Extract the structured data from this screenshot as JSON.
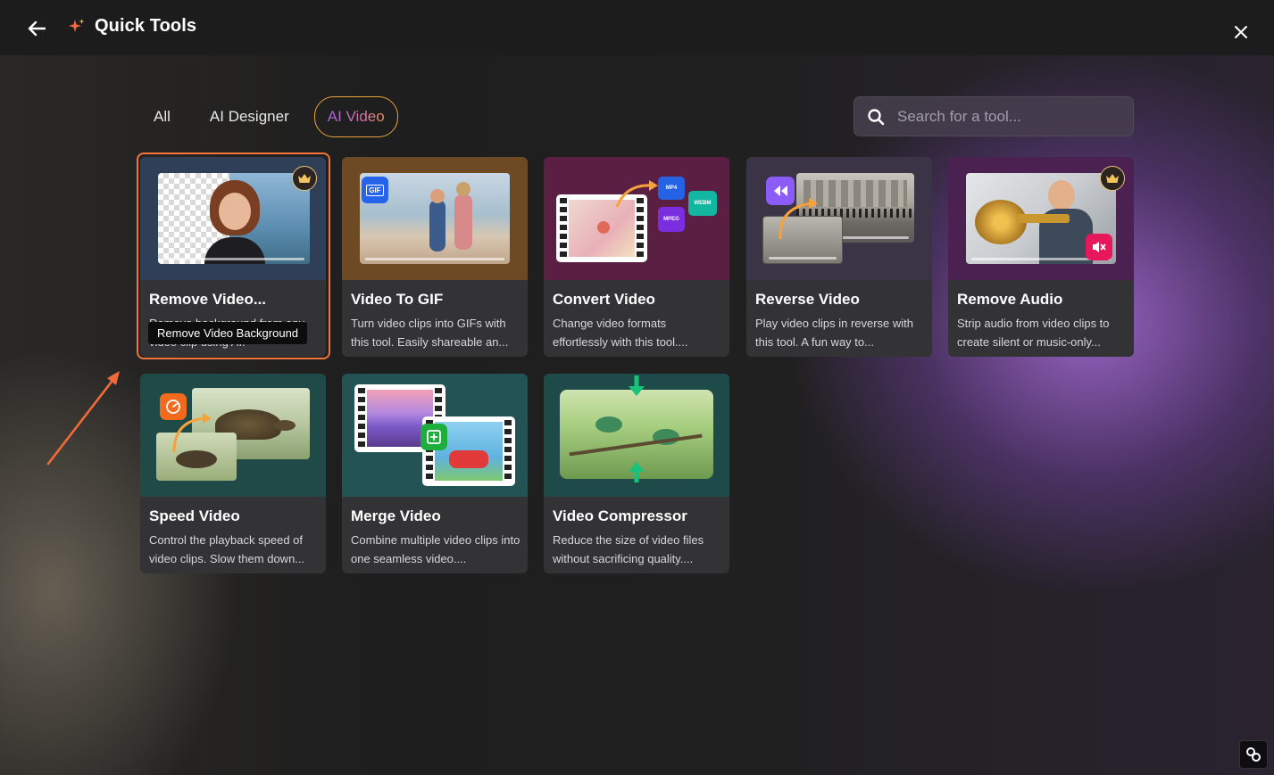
{
  "header": {
    "title": "Quick Tools"
  },
  "tabs": [
    {
      "label": "All"
    },
    {
      "label": "AI Designer"
    },
    {
      "label": "AI Video"
    }
  ],
  "search": {
    "placeholder": "Search for a tool..."
  },
  "cards": [
    {
      "title": "Remove Video...",
      "desc": "Remove background from any video clip using AI.",
      "premium": true,
      "thumb_bg": "#2e3f57"
    },
    {
      "title": "Video To GIF",
      "desc": "Turn video clips into GIFs with this tool. Easily shareable an...",
      "premium": false,
      "thumb_bg": "#6d4a24",
      "badge": "GIF"
    },
    {
      "title": "Convert Video",
      "desc": "Change video formats effortlessly with this tool....",
      "premium": false,
      "thumb_bg": "#5a1f42",
      "formats": [
        "MP4",
        "WEBM",
        "MPEG"
      ]
    },
    {
      "title": "Reverse Video",
      "desc": "Play video clips in reverse with this tool. A fun way to...",
      "premium": false,
      "thumb_bg": "#3a3446"
    },
    {
      "title": "Remove Audio",
      "desc": "Strip audio from video clips to create silent or music-only...",
      "premium": true,
      "thumb_bg": "#4a2150"
    },
    {
      "title": "Speed Video",
      "desc": "Control the playback speed of video clips. Slow them down...",
      "premium": false,
      "thumb_bg": "#1f4a48"
    },
    {
      "title": "Merge Video",
      "desc": "Combine multiple video clips into one seamless video....",
      "premium": false,
      "thumb_bg": "#235354"
    },
    {
      "title": "Video Compressor",
      "desc": "Reduce the size of video files without sacrificing quality....",
      "premium": false,
      "thumb_bg": "#1e4a4a"
    }
  ],
  "tooltip": {
    "text": "Remove Video Background"
  },
  "colors": {
    "accent_orange": "#f5733d",
    "tab_active_border": "#e9a23b"
  }
}
